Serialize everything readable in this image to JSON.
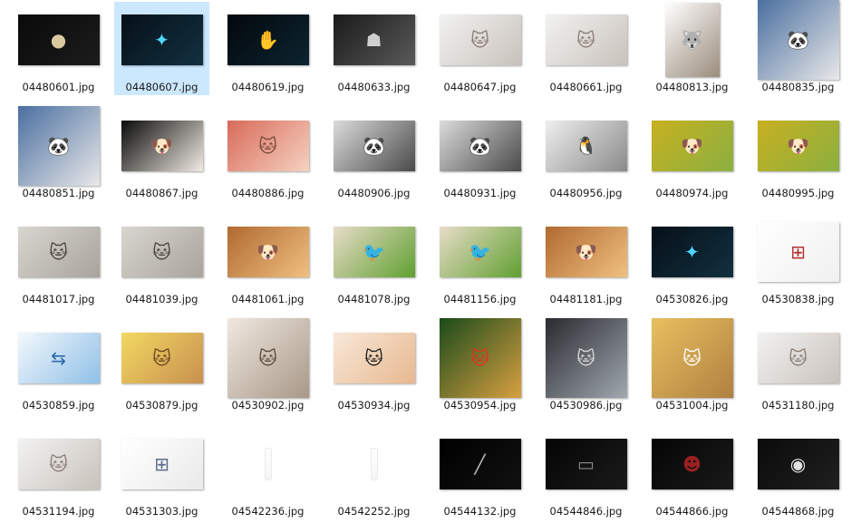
{
  "view": {
    "name": "large-icons-folder-view",
    "selected_file": "04480607.jpg"
  },
  "files": [
    {
      "name": "04480601.jpg",
      "thumb": "dark-egg-logo",
      "colors": [
        "#0a0a0a",
        "#1c1c1c"
      ],
      "accent": "#d9c9a0",
      "glyph": "●",
      "shape": "wide"
    },
    {
      "name": "04480607.jpg",
      "thumb": "dark-blue-glow",
      "colors": [
        "#061018",
        "#123040"
      ],
      "accent": "#4fd7ff",
      "glyph": "✦",
      "shape": "wide",
      "selected": true
    },
    {
      "name": "04480619.jpg",
      "thumb": "neon-handprint",
      "colors": [
        "#02080c",
        "#0d2430"
      ],
      "accent": "#3fc6ff",
      "glyph": "✋",
      "shape": "wide"
    },
    {
      "name": "04480633.jpg",
      "thumb": "dark-figure",
      "colors": [
        "#1a1a1a",
        "#5a5a5a"
      ],
      "accent": "#cfcfcf",
      "glyph": "☗",
      "shape": "wide"
    },
    {
      "name": "04480647.jpg",
      "thumb": "kitten-white",
      "colors": [
        "#f2f2f2",
        "#c9c2bb"
      ],
      "accent": "#8a7d72",
      "glyph": "🐱",
      "shape": "wide"
    },
    {
      "name": "04480661.jpg",
      "thumb": "kitten-white",
      "colors": [
        "#f2f2f2",
        "#c9c2bb"
      ],
      "accent": "#8a7d72",
      "glyph": "🐱",
      "shape": "wide"
    },
    {
      "name": "04480813.jpg",
      "thumb": "husky-puppy",
      "colors": [
        "#ffffff",
        "#9a8c7c"
      ],
      "accent": "#4a4038",
      "glyph": "🐺",
      "shape": "tall"
    },
    {
      "name": "04480835.jpg",
      "thumb": "panda-plush",
      "colors": [
        "#4a6fa0",
        "#e8e8e8"
      ],
      "accent": "#111111",
      "glyph": "🐼",
      "shape": "square"
    },
    {
      "name": "04480851.jpg",
      "thumb": "panda-plush",
      "colors": [
        "#4a6fa0",
        "#e8e8e8"
      ],
      "accent": "#111111",
      "glyph": "🐼",
      "shape": "square"
    },
    {
      "name": "04480867.jpg",
      "thumb": "dog-glasses",
      "colors": [
        "#0a0a0a",
        "#f1ece4"
      ],
      "accent": "#222222",
      "glyph": "🐶",
      "shape": "wide"
    },
    {
      "name": "04480886.jpg",
      "thumb": "kitten-blanket",
      "colors": [
        "#d96a5a",
        "#f5d2c0"
      ],
      "accent": "#7a4a3a",
      "glyph": "🐱",
      "shape": "wide"
    },
    {
      "name": "04480906.jpg",
      "thumb": "baby-panda",
      "colors": [
        "#dcdcdc",
        "#4a4a4a"
      ],
      "accent": "#111111",
      "glyph": "🐼",
      "shape": "wide"
    },
    {
      "name": "04480931.jpg",
      "thumb": "baby-panda",
      "colors": [
        "#dcdcdc",
        "#4a4a4a"
      ],
      "accent": "#111111",
      "glyph": "🐼",
      "shape": "wide"
    },
    {
      "name": "04480956.jpg",
      "thumb": "penguin-chicks",
      "colors": [
        "#efefef",
        "#8a8a8a"
      ],
      "accent": "#222222",
      "glyph": "🐧",
      "shape": "wide"
    },
    {
      "name": "04480974.jpg",
      "thumb": "puppies-field",
      "colors": [
        "#c8b020",
        "#8ab040"
      ],
      "accent": "#3a6ec0",
      "glyph": "🐶",
      "shape": "wide"
    },
    {
      "name": "04480995.jpg",
      "thumb": "puppies-field",
      "colors": [
        "#c8b020",
        "#8ab040"
      ],
      "accent": "#3a6ec0",
      "glyph": "🐶",
      "shape": "wide"
    },
    {
      "name": "04481017.jpg",
      "thumb": "kitten-text",
      "colors": [
        "#d8d6d0",
        "#a8a49c"
      ],
      "accent": "#4a4438",
      "glyph": "🐱",
      "shape": "wide"
    },
    {
      "name": "04481039.jpg",
      "thumb": "kitten-text",
      "colors": [
        "#d8d6d0",
        "#a8a49c"
      ],
      "accent": "#4a4438",
      "glyph": "🐱",
      "shape": "wide"
    },
    {
      "name": "04481061.jpg",
      "thumb": "golden-puppies",
      "colors": [
        "#b06a30",
        "#f0c080"
      ],
      "accent": "#7a3a10",
      "glyph": "🐶",
      "shape": "wide"
    },
    {
      "name": "04481078.jpg",
      "thumb": "lovebirds",
      "colors": [
        "#e8dcc8",
        "#60a030"
      ],
      "accent": "#e06a20",
      "glyph": "🐦",
      "shape": "wide"
    },
    {
      "name": "04481156.jpg",
      "thumb": "lovebirds",
      "colors": [
        "#e8dcc8",
        "#60a030"
      ],
      "accent": "#e06a20",
      "glyph": "🐦",
      "shape": "wide"
    },
    {
      "name": "04481181.jpg",
      "thumb": "golden-puppies",
      "colors": [
        "#b06a30",
        "#f0c080"
      ],
      "accent": "#7a3a10",
      "glyph": "🐶",
      "shape": "wide"
    },
    {
      "name": "04530826.jpg",
      "thumb": "dark-blue-glow",
      "colors": [
        "#061018",
        "#123040"
      ],
      "accent": "#4fd7ff",
      "glyph": "✦",
      "shape": "wide"
    },
    {
      "name": "04530838.jpg",
      "thumb": "slide-diagram",
      "colors": [
        "#ffffff",
        "#f0f0f0"
      ],
      "accent": "#b03030",
      "glyph": "⊞",
      "shape": "paper"
    },
    {
      "name": "04530859.jpg",
      "thumb": "network-diagram",
      "colors": [
        "#f4f8fc",
        "#8ec0e8"
      ],
      "accent": "#2a6aa8",
      "glyph": "⇆",
      "shape": "wide"
    },
    {
      "name": "04530879.jpg",
      "thumb": "smiling-kitten",
      "colors": [
        "#f2d860",
        "#c89050"
      ],
      "accent": "#6a4420",
      "glyph": "🐱",
      "shape": "wide"
    },
    {
      "name": "04530902.jpg",
      "thumb": "kitten-lying",
      "colors": [
        "#f0e8e0",
        "#a89888"
      ],
      "accent": "#5a4a3a",
      "glyph": "🐱",
      "shape": "square"
    },
    {
      "name": "04530934.jpg",
      "thumb": "sleeping-kittens",
      "colors": [
        "#f8e8d8",
        "#e8b890"
      ],
      "accent": "#202020",
      "glyph": "🐱",
      "shape": "wide"
    },
    {
      "name": "04530954.jpg",
      "thumb": "kittens-flowers",
      "colors": [
        "#1a4a1a",
        "#d8a040"
      ],
      "accent": "#e03020",
      "glyph": "🐱",
      "shape": "square"
    },
    {
      "name": "04530986.jpg",
      "thumb": "gray-kitten",
      "colors": [
        "#2a2a30",
        "#a0a8b0"
      ],
      "accent": "#d8d8d8",
      "glyph": "🐱",
      "shape": "square"
    },
    {
      "name": "04531004.jpg",
      "thumb": "kittens-cups",
      "colors": [
        "#e8c060",
        "#b08040"
      ],
      "accent": "#ffffff",
      "glyph": "🐱",
      "shape": "square"
    },
    {
      "name": "04531180.jpg",
      "thumb": "kitten-white",
      "colors": [
        "#f2f2f2",
        "#c9c2bb"
      ],
      "accent": "#8a7d72",
      "glyph": "🐱",
      "shape": "wide"
    },
    {
      "name": "04531194.jpg",
      "thumb": "kitten-white",
      "colors": [
        "#f2f2f2",
        "#c9c2bb"
      ],
      "accent": "#8a7d72",
      "glyph": "🐱",
      "shape": "wide"
    },
    {
      "name": "04531303.jpg",
      "thumb": "flowchart",
      "colors": [
        "#ffffff",
        "#eaeaea"
      ],
      "accent": "#5a6a8a",
      "glyph": "⊞",
      "shape": "wide"
    },
    {
      "name": "04542236.jpg",
      "thumb": "blank-slim",
      "colors": [
        "#ffffff",
        "#f4f4f4"
      ],
      "accent": "#cccccc",
      "glyph": "",
      "shape": "slim"
    },
    {
      "name": "04542252.jpg",
      "thumb": "blank-slim",
      "colors": [
        "#ffffff",
        "#f4f4f4"
      ],
      "accent": "#cccccc",
      "glyph": "",
      "shape": "slim"
    },
    {
      "name": "04544132.jpg",
      "thumb": "dark-light-streak",
      "colors": [
        "#000000",
        "#111111"
      ],
      "accent": "#bbbbbb",
      "glyph": "╱",
      "shape": "wide"
    },
    {
      "name": "04544846.jpg",
      "thumb": "dark-text",
      "colors": [
        "#050505",
        "#1a1a1a"
      ],
      "accent": "#8a8a8a",
      "glyph": "▭",
      "shape": "wide"
    },
    {
      "name": "04544866.jpg",
      "thumb": "anonymous-mask",
      "colors": [
        "#050505",
        "#1a1a1a"
      ],
      "accent": "#9a2020",
      "glyph": "☻",
      "shape": "wide"
    },
    {
      "name": "04544868.jpg",
      "thumb": "os-logo-dark",
      "colors": [
        "#0a0a0a",
        "#202020"
      ],
      "accent": "#e0e0e0",
      "glyph": "◉",
      "shape": "wide"
    }
  ]
}
